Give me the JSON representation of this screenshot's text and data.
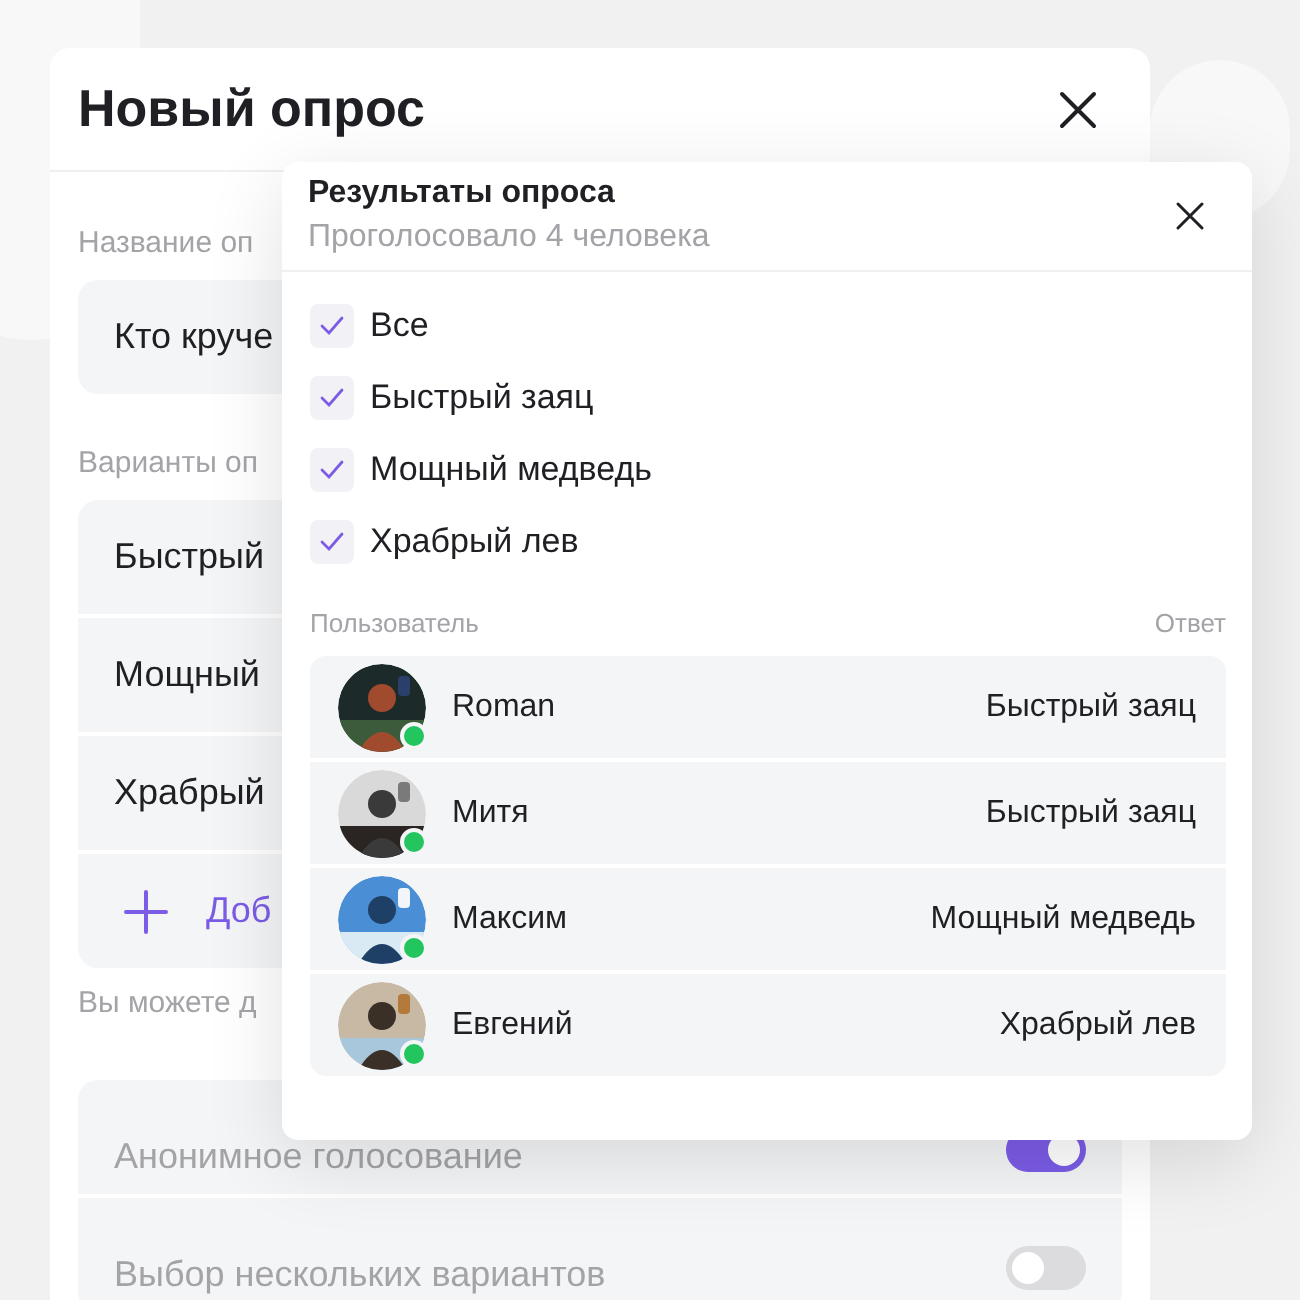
{
  "dialog": {
    "title": "Новый опрос",
    "name_label": "Название оп",
    "name_value": "Кто круче",
    "options_label": "Варианты оп",
    "options": [
      "Быстрый",
      "Мощный",
      "Храбрый"
    ],
    "add_option": "Доб",
    "hint": "Вы можете д",
    "settings": [
      {
        "label": "Анонимное голосование",
        "on": true
      },
      {
        "label": "Выбор нескольких вариантов",
        "on": false
      }
    ]
  },
  "results": {
    "title": "Результаты опроса",
    "subtitle": "Проголосовало 4 человека",
    "filters": [
      {
        "label": "Все",
        "checked": true
      },
      {
        "label": "Быстрый заяц",
        "checked": true
      },
      {
        "label": "Мощный медведь",
        "checked": true
      },
      {
        "label": "Храбрый лев",
        "checked": true
      }
    ],
    "columns": [
      "Пользователь",
      "Ответ"
    ],
    "rows": [
      {
        "user": "Roman",
        "answer": "Быстрый заяц",
        "online": true
      },
      {
        "user": "Митя",
        "answer": "Быстрый заяц",
        "online": true
      },
      {
        "user": "Максим",
        "answer": "Мощный медведь",
        "online": true
      },
      {
        "user": "Евгений",
        "answer": "Храбрый лев",
        "online": true
      }
    ]
  }
}
